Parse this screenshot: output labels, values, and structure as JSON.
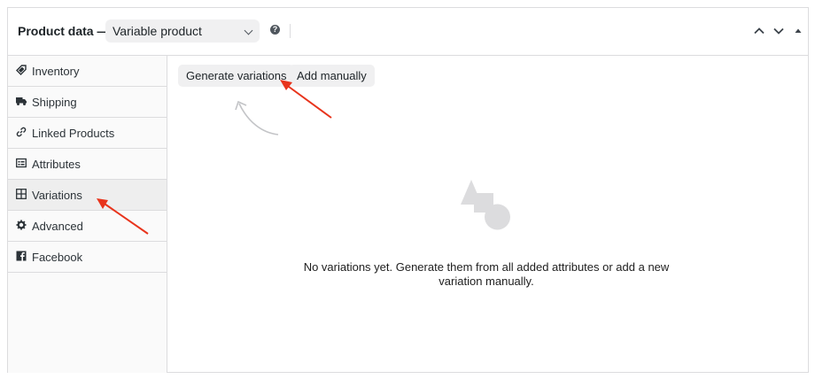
{
  "header": {
    "title": "Product data —",
    "product_type": "Variable product",
    "help_icon": "question-circle-icon",
    "controls": [
      "chevron-up-icon",
      "chevron-down-icon",
      "triangle-up-icon"
    ]
  },
  "tabs": [
    {
      "label": "Inventory",
      "icon": "tag-icon"
    },
    {
      "label": "Shipping",
      "icon": "truck-icon"
    },
    {
      "label": "Linked Products",
      "icon": "link-icon"
    },
    {
      "label": "Attributes",
      "icon": "list-icon"
    },
    {
      "label": "Variations",
      "icon": "grid-icon",
      "active": true
    },
    {
      "label": "Advanced",
      "icon": "gear-icon"
    },
    {
      "label": "Facebook",
      "icon": "facebook-icon"
    }
  ],
  "actions": {
    "generate_label": "Generate variations",
    "add_manual_label": "Add manually"
  },
  "empty_state": {
    "icon": "shapes-icon",
    "message": "No variations yet. Generate them from all added attributes or add a new variation manually."
  },
  "colors": {
    "accent_arrow": "#e8341c",
    "border": "#dcdcde",
    "button_bg": "#f0f0f1",
    "active_tab_bg": "#eeeeee"
  }
}
